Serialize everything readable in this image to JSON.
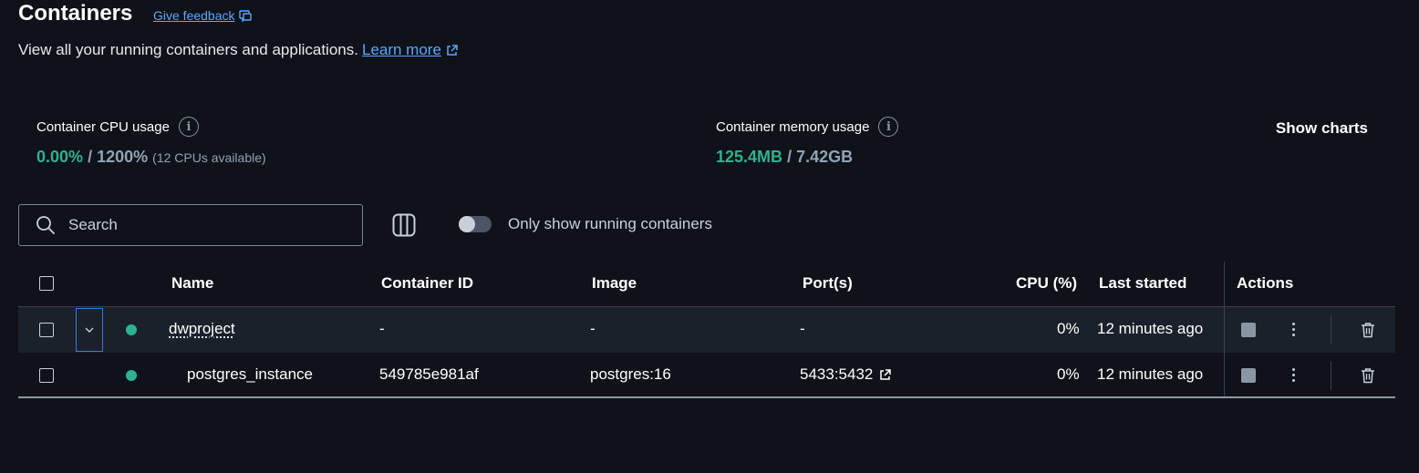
{
  "header": {
    "title": "Containers",
    "feedback_label": "Give feedback",
    "subtitle": "View all your running containers and applications.",
    "learn_more": "Learn more"
  },
  "stats": {
    "cpu": {
      "label": "Container CPU usage",
      "used": "0.00%",
      "separator": "/",
      "total": "1200%",
      "note": "(12 CPUs available)"
    },
    "memory": {
      "label": "Container memory usage",
      "used": "125.4MB",
      "separator": "/",
      "total": "7.42GB"
    },
    "show_charts": "Show charts"
  },
  "toolbar": {
    "search_placeholder": "Search",
    "toggle_label": "Only show running containers",
    "toggle_on": false
  },
  "table": {
    "columns": {
      "name": "Name",
      "container_id": "Container ID",
      "image": "Image",
      "ports": "Port(s)",
      "cpu": "CPU (%)",
      "last_started": "Last started",
      "actions": "Actions"
    },
    "rows": [
      {
        "name": "dwproject",
        "container_id": "-",
        "image": "-",
        "ports": "-",
        "cpu": "0%",
        "last_started": "12 minutes ago",
        "status_color": "#2db38e"
      },
      {
        "name": "postgres_instance",
        "container_id": "549785e981af",
        "image": "postgres:16",
        "ports": "5433:5432",
        "cpu": "0%",
        "last_started": "12 minutes ago",
        "status_color": "#2db38e"
      }
    ]
  },
  "colors": {
    "background": "#0f1218",
    "accent_link": "#5aa7ff",
    "running_green": "#2db38e"
  }
}
